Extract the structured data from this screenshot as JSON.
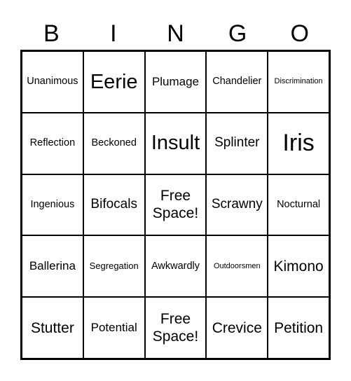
{
  "header": [
    "B",
    "I",
    "N",
    "G",
    "O"
  ],
  "cells": [
    [
      "Unanimous",
      "Eerie",
      "Plumage",
      "Chandelier",
      "Discrimination"
    ],
    [
      "Reflection",
      "Beckoned",
      "Insult",
      "Splinter",
      "Iris"
    ],
    [
      "Ingenious",
      "Bifocals",
      "Free Space!",
      "Scrawny",
      "Nocturnal"
    ],
    [
      "Ballerina",
      "Segregation",
      "Awkwardly",
      "Outdoorsmen",
      "Kimono"
    ],
    [
      "Stutter",
      "Potential",
      "Free Space!",
      "Crevice",
      "Petition"
    ]
  ]
}
